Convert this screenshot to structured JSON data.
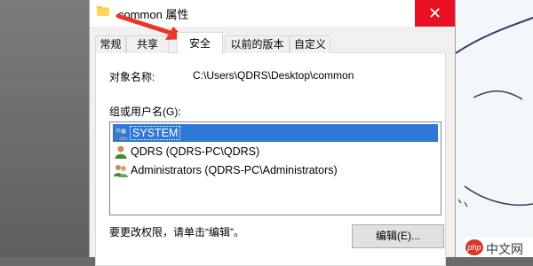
{
  "window": {
    "title": "common 属性",
    "close_symbol": "✕",
    "folder_icon": "folder-icon"
  },
  "tabs": [
    {
      "label": "常规",
      "active": false
    },
    {
      "label": "共享",
      "active": false
    },
    {
      "label": "安全",
      "active": true
    },
    {
      "label": "以前的版本",
      "active": false
    },
    {
      "label": "自定义",
      "active": false
    }
  ],
  "security": {
    "object_name_label": "对象名称:",
    "object_name_value": "C:\\Users\\QDRS\\Desktop\\common",
    "group_label": "组或用户名(G):",
    "users": [
      {
        "name": "SYSTEM",
        "icon": "user-group-icon",
        "selected": true
      },
      {
        "name": "QDRS (QDRS-PC\\QDRS)",
        "icon": "user-icon",
        "selected": false
      },
      {
        "name": "Administrators (QDRS-PC\\Administrators)",
        "icon": "user-group-icon",
        "selected": false
      }
    ],
    "change_hint": "要更改权限，请单击“编辑”。",
    "edit_button": "编辑(E)..."
  },
  "watermark": {
    "logo": "php",
    "text": "中文网"
  },
  "colors": {
    "close_red": "#e81123",
    "selection_blue": "#3078d6",
    "arrow_red": "#e8372b"
  }
}
